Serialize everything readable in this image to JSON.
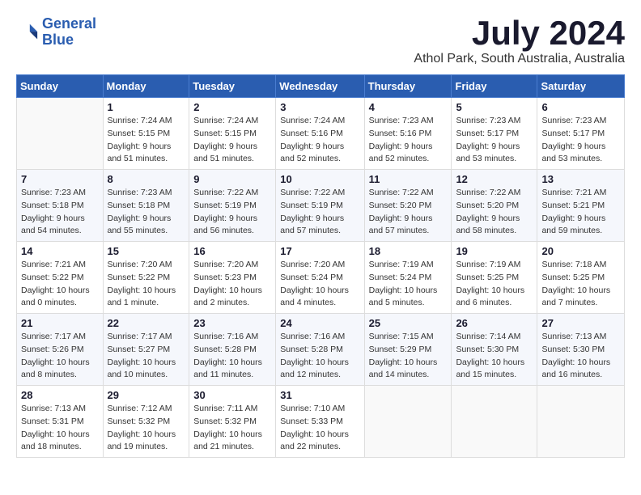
{
  "header": {
    "logo_line1": "General",
    "logo_line2": "Blue",
    "month": "July 2024",
    "location": "Athol Park, South Australia, Australia"
  },
  "days_of_week": [
    "Sunday",
    "Monday",
    "Tuesday",
    "Wednesday",
    "Thursday",
    "Friday",
    "Saturday"
  ],
  "weeks": [
    [
      {
        "day": "",
        "info": ""
      },
      {
        "day": "1",
        "info": "Sunrise: 7:24 AM\nSunset: 5:15 PM\nDaylight: 9 hours\nand 51 minutes."
      },
      {
        "day": "2",
        "info": "Sunrise: 7:24 AM\nSunset: 5:15 PM\nDaylight: 9 hours\nand 51 minutes."
      },
      {
        "day": "3",
        "info": "Sunrise: 7:24 AM\nSunset: 5:16 PM\nDaylight: 9 hours\nand 52 minutes."
      },
      {
        "day": "4",
        "info": "Sunrise: 7:23 AM\nSunset: 5:16 PM\nDaylight: 9 hours\nand 52 minutes."
      },
      {
        "day": "5",
        "info": "Sunrise: 7:23 AM\nSunset: 5:17 PM\nDaylight: 9 hours\nand 53 minutes."
      },
      {
        "day": "6",
        "info": "Sunrise: 7:23 AM\nSunset: 5:17 PM\nDaylight: 9 hours\nand 53 minutes."
      }
    ],
    [
      {
        "day": "7",
        "info": "Sunrise: 7:23 AM\nSunset: 5:18 PM\nDaylight: 9 hours\nand 54 minutes."
      },
      {
        "day": "8",
        "info": "Sunrise: 7:23 AM\nSunset: 5:18 PM\nDaylight: 9 hours\nand 55 minutes."
      },
      {
        "day": "9",
        "info": "Sunrise: 7:22 AM\nSunset: 5:19 PM\nDaylight: 9 hours\nand 56 minutes."
      },
      {
        "day": "10",
        "info": "Sunrise: 7:22 AM\nSunset: 5:19 PM\nDaylight: 9 hours\nand 57 minutes."
      },
      {
        "day": "11",
        "info": "Sunrise: 7:22 AM\nSunset: 5:20 PM\nDaylight: 9 hours\nand 57 minutes."
      },
      {
        "day": "12",
        "info": "Sunrise: 7:22 AM\nSunset: 5:20 PM\nDaylight: 9 hours\nand 58 minutes."
      },
      {
        "day": "13",
        "info": "Sunrise: 7:21 AM\nSunset: 5:21 PM\nDaylight: 9 hours\nand 59 minutes."
      }
    ],
    [
      {
        "day": "14",
        "info": "Sunrise: 7:21 AM\nSunset: 5:22 PM\nDaylight: 10 hours\nand 0 minutes."
      },
      {
        "day": "15",
        "info": "Sunrise: 7:20 AM\nSunset: 5:22 PM\nDaylight: 10 hours\nand 1 minute."
      },
      {
        "day": "16",
        "info": "Sunrise: 7:20 AM\nSunset: 5:23 PM\nDaylight: 10 hours\nand 2 minutes."
      },
      {
        "day": "17",
        "info": "Sunrise: 7:20 AM\nSunset: 5:24 PM\nDaylight: 10 hours\nand 4 minutes."
      },
      {
        "day": "18",
        "info": "Sunrise: 7:19 AM\nSunset: 5:24 PM\nDaylight: 10 hours\nand 5 minutes."
      },
      {
        "day": "19",
        "info": "Sunrise: 7:19 AM\nSunset: 5:25 PM\nDaylight: 10 hours\nand 6 minutes."
      },
      {
        "day": "20",
        "info": "Sunrise: 7:18 AM\nSunset: 5:25 PM\nDaylight: 10 hours\nand 7 minutes."
      }
    ],
    [
      {
        "day": "21",
        "info": "Sunrise: 7:17 AM\nSunset: 5:26 PM\nDaylight: 10 hours\nand 8 minutes."
      },
      {
        "day": "22",
        "info": "Sunrise: 7:17 AM\nSunset: 5:27 PM\nDaylight: 10 hours\nand 10 minutes."
      },
      {
        "day": "23",
        "info": "Sunrise: 7:16 AM\nSunset: 5:28 PM\nDaylight: 10 hours\nand 11 minutes."
      },
      {
        "day": "24",
        "info": "Sunrise: 7:16 AM\nSunset: 5:28 PM\nDaylight: 10 hours\nand 12 minutes."
      },
      {
        "day": "25",
        "info": "Sunrise: 7:15 AM\nSunset: 5:29 PM\nDaylight: 10 hours\nand 14 minutes."
      },
      {
        "day": "26",
        "info": "Sunrise: 7:14 AM\nSunset: 5:30 PM\nDaylight: 10 hours\nand 15 minutes."
      },
      {
        "day": "27",
        "info": "Sunrise: 7:13 AM\nSunset: 5:30 PM\nDaylight: 10 hours\nand 16 minutes."
      }
    ],
    [
      {
        "day": "28",
        "info": "Sunrise: 7:13 AM\nSunset: 5:31 PM\nDaylight: 10 hours\nand 18 minutes."
      },
      {
        "day": "29",
        "info": "Sunrise: 7:12 AM\nSunset: 5:32 PM\nDaylight: 10 hours\nand 19 minutes."
      },
      {
        "day": "30",
        "info": "Sunrise: 7:11 AM\nSunset: 5:32 PM\nDaylight: 10 hours\nand 21 minutes."
      },
      {
        "day": "31",
        "info": "Sunrise: 7:10 AM\nSunset: 5:33 PM\nDaylight: 10 hours\nand 22 minutes."
      },
      {
        "day": "",
        "info": ""
      },
      {
        "day": "",
        "info": ""
      },
      {
        "day": "",
        "info": ""
      }
    ]
  ]
}
